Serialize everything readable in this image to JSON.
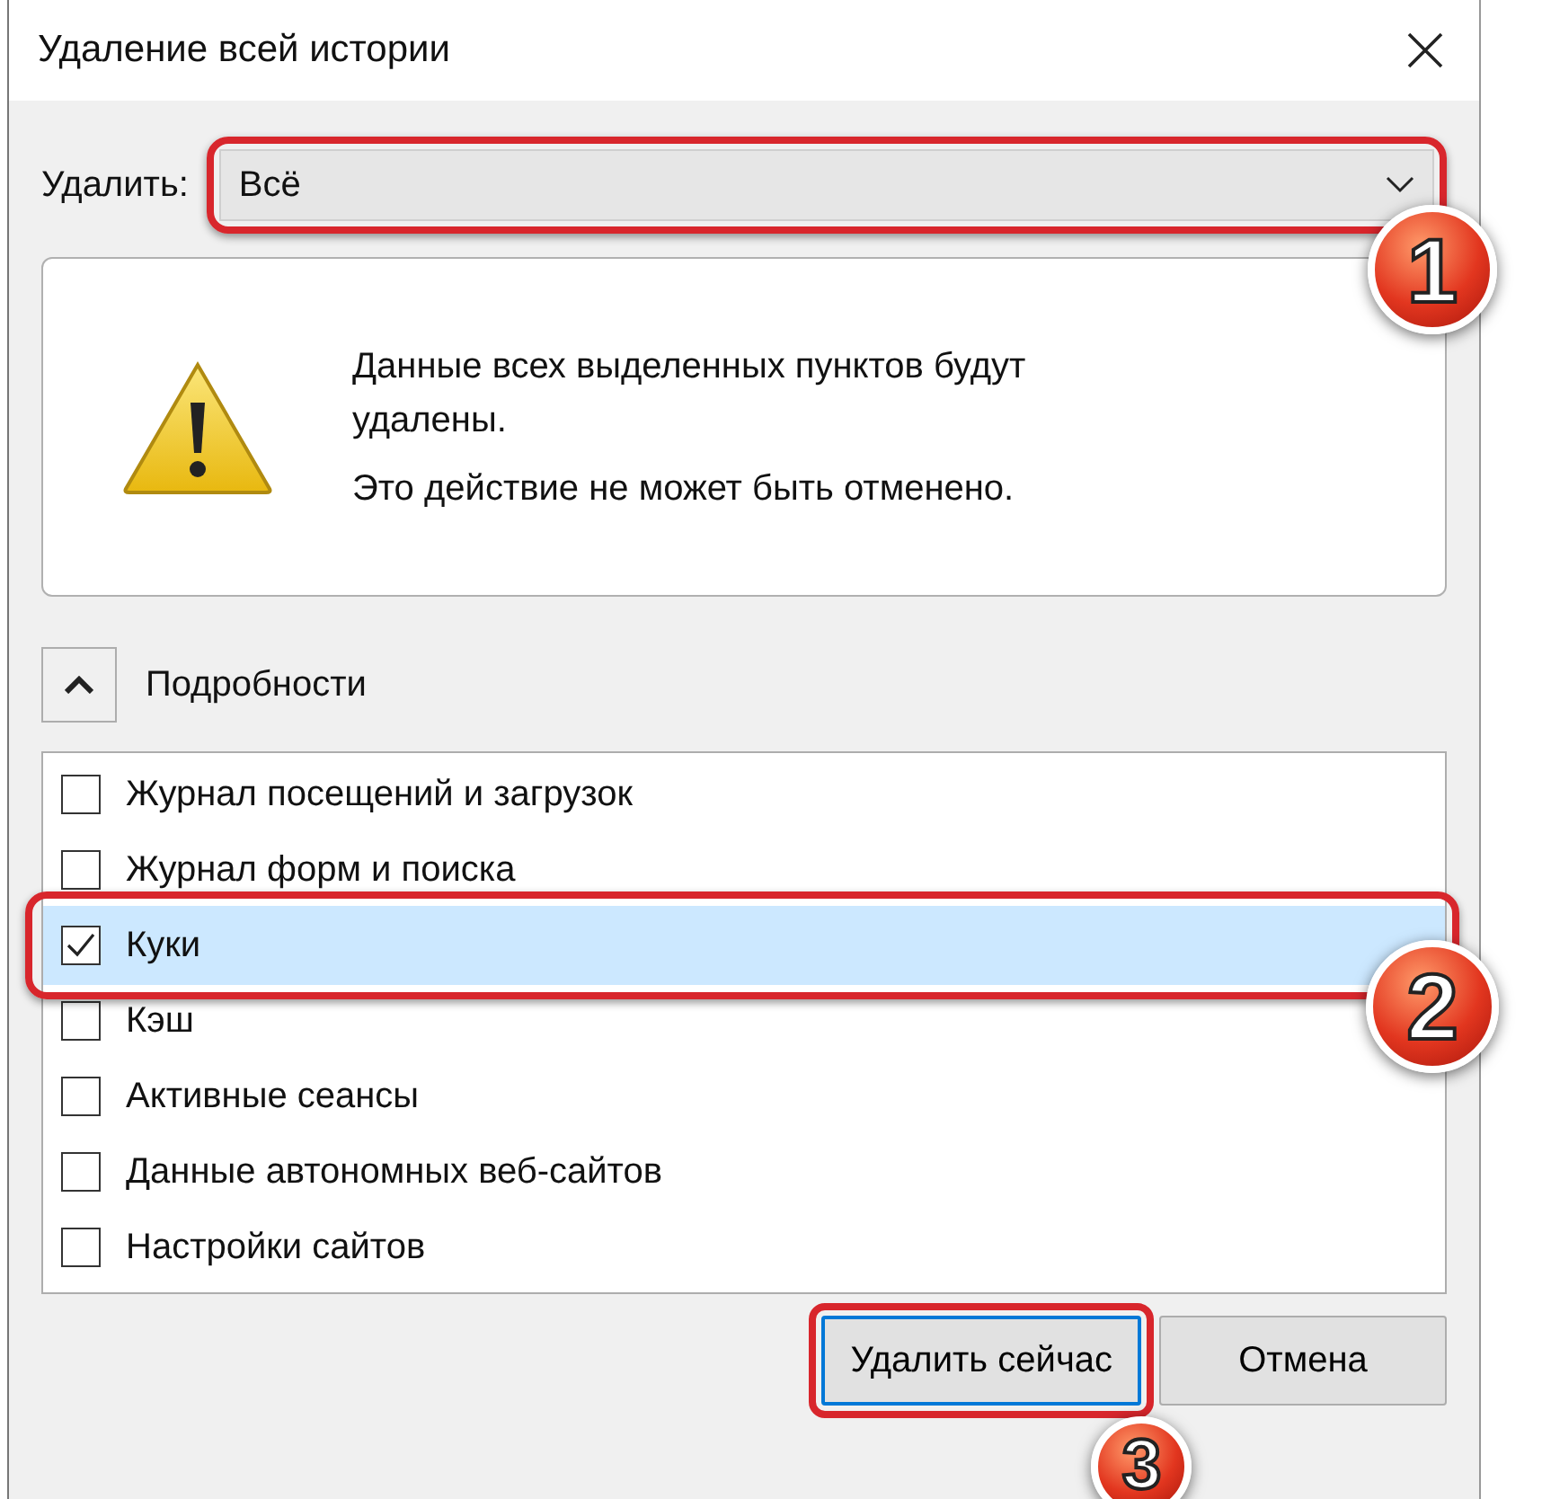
{
  "window": {
    "title": "Удаление всей истории"
  },
  "range": {
    "label": "Удалить:",
    "value": "Всё",
    "highlighted": true,
    "callout": "1"
  },
  "warning": {
    "lines": [
      "Данные всех выделенных пунктов будут удалены.",
      "Это действие не может быть отменено."
    ]
  },
  "details": {
    "label": "Подробности",
    "expanded": true
  },
  "items": [
    {
      "label": "Журнал посещений и загрузок",
      "checked": false,
      "selected": false,
      "highlighted": false
    },
    {
      "label": "Журнал форм и поиска",
      "checked": false,
      "selected": false,
      "highlighted": false
    },
    {
      "label": "Куки",
      "checked": true,
      "selected": true,
      "highlighted": true,
      "callout": "2"
    },
    {
      "label": "Кэш",
      "checked": false,
      "selected": false,
      "highlighted": false
    },
    {
      "label": "Активные сеансы",
      "checked": false,
      "selected": false,
      "highlighted": false
    },
    {
      "label": "Данные автономных веб-сайтов",
      "checked": false,
      "selected": false,
      "highlighted": false
    },
    {
      "label": "Настройки сайтов",
      "checked": false,
      "selected": false,
      "highlighted": false
    }
  ],
  "buttons": [
    {
      "label": "Удалить сейчас",
      "highlighted": true,
      "callout": "3"
    },
    {
      "label": "Отмена",
      "highlighted": false
    }
  ]
}
